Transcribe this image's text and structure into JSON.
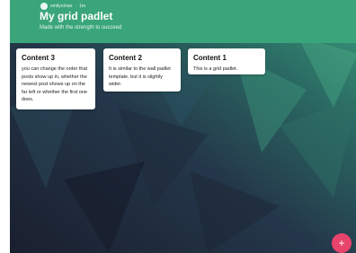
{
  "header": {
    "username": "emilyrohan",
    "time": "1m",
    "title": "My grid padlet",
    "subtitle": "Made with the strength to succeed"
  },
  "cards": [
    {
      "title": "Content 3",
      "body": "you can change the order that posts show up in, whether the newest post shows up on the far left or whether the first one does."
    },
    {
      "title": "Content 2",
      "body": "It is similar to the wall padlet template, but it is slightly wider."
    },
    {
      "title": "Content 1",
      "body": "This is a grid padlet."
    }
  ],
  "fab": {
    "label": "+"
  },
  "colors": {
    "header": "#3aa57a",
    "fab": "#e8436b"
  },
  "icons": {
    "card_menu": "kebab-icon",
    "add": "plus-icon",
    "avatar": "avatar"
  }
}
